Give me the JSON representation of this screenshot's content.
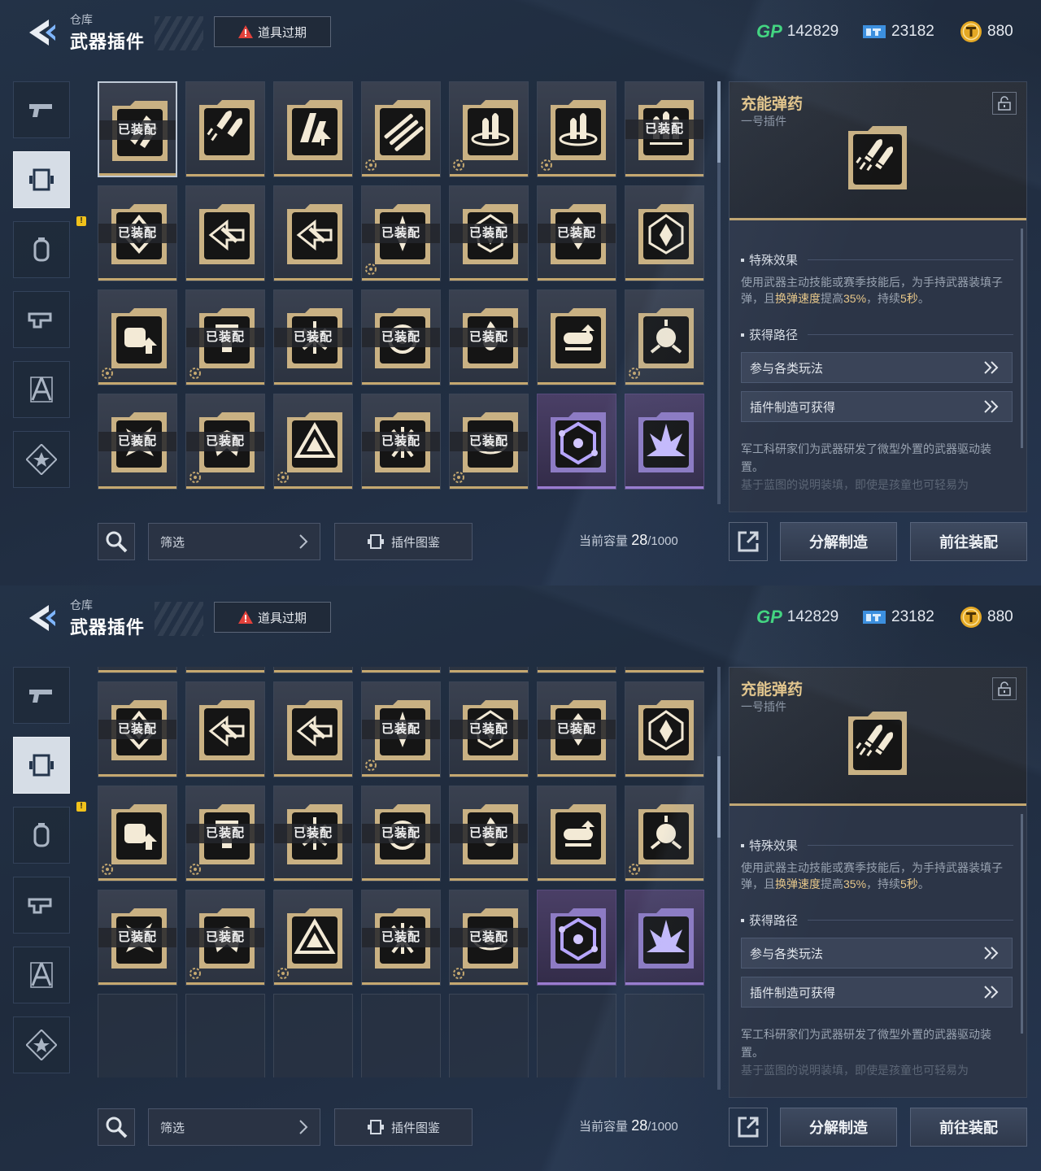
{
  "header": {
    "breadcrumb": "仓库",
    "title": "武器插件",
    "expire_label": "道具过期",
    "currencies": [
      {
        "icon": "gp-icon",
        "label": "GP",
        "value": "142829"
      },
      {
        "icon": "ticket-icon",
        "value": "23182"
      },
      {
        "icon": "coin-icon",
        "value": "880"
      }
    ]
  },
  "sidebar": {
    "tabs": [
      {
        "name": "pistol",
        "icon": "pistol-icon",
        "active": false
      },
      {
        "name": "plugin",
        "icon": "plugin-icon",
        "active": true
      },
      {
        "name": "grenade",
        "icon": "grenade-icon",
        "active": false,
        "alert": "!"
      },
      {
        "name": "gun-mod",
        "icon": "gun-mod-icon",
        "active": false
      },
      {
        "name": "compass",
        "icon": "compass-icon",
        "active": false
      },
      {
        "name": "star-badge",
        "icon": "star-badge-icon",
        "active": false
      }
    ]
  },
  "grid": {
    "equipped_label": "已装配",
    "items": [
      {
        "id": 1,
        "icon": "rockets-icon",
        "equipped": true,
        "selected": true,
        "rarity": "gold"
      },
      {
        "id": 2,
        "icon": "charged-rounds-icon",
        "equipped": false,
        "rarity": "gold"
      },
      {
        "id": 3,
        "icon": "ammo-up-icon",
        "equipped": false,
        "rarity": "gold"
      },
      {
        "id": 4,
        "icon": "missile-trio-icon",
        "equipped": false,
        "rarity": "gold",
        "gear": true
      },
      {
        "id": 5,
        "icon": "bullet-ring-icon",
        "equipped": false,
        "rarity": "gold",
        "gear": true
      },
      {
        "id": 6,
        "icon": "bullet-ring-icon",
        "equipped": false,
        "rarity": "gold",
        "gear": true
      },
      {
        "id": 7,
        "icon": "bullet-burst-icon",
        "equipped": true,
        "rarity": "gold"
      },
      {
        "id": 8,
        "icon": "diamond-icon",
        "equipped": true,
        "rarity": "gold"
      },
      {
        "id": 9,
        "icon": "dash-arrow-icon",
        "equipped": false,
        "rarity": "gold"
      },
      {
        "id": 10,
        "icon": "dash-arrow-icon",
        "equipped": false,
        "rarity": "gold"
      },
      {
        "id": 11,
        "icon": "spike-icon",
        "equipped": true,
        "rarity": "gold",
        "gear": true
      },
      {
        "id": 12,
        "icon": "shield-core-icon",
        "equipped": true,
        "rarity": "gold"
      },
      {
        "id": 13,
        "icon": "crystal-icon",
        "equipped": true,
        "rarity": "gold"
      },
      {
        "id": 14,
        "icon": "crystal-frame-icon",
        "equipped": false,
        "rarity": "gold"
      },
      {
        "id": 15,
        "icon": "fist-up-icon",
        "equipped": false,
        "rarity": "gold",
        "gear": true
      },
      {
        "id": 16,
        "icon": "tower-icon",
        "equipped": true,
        "rarity": "gold",
        "gear": true
      },
      {
        "id": 17,
        "icon": "blast-icon",
        "equipped": true,
        "rarity": "gold"
      },
      {
        "id": 18,
        "icon": "core-burst-icon",
        "equipped": true,
        "rarity": "gold"
      },
      {
        "id": 19,
        "icon": "flame-icon",
        "equipped": true,
        "rarity": "gold"
      },
      {
        "id": 20,
        "icon": "cartridge-icon",
        "equipped": false,
        "rarity": "gold"
      },
      {
        "id": 21,
        "icon": "explosion-icon",
        "equipped": false,
        "rarity": "gold",
        "gear": true
      },
      {
        "id": 22,
        "icon": "shatter-icon",
        "equipped": true,
        "rarity": "gold"
      },
      {
        "id": 23,
        "icon": "wing-icon",
        "equipped": true,
        "rarity": "gold",
        "gear": true
      },
      {
        "id": 24,
        "icon": "pyramid-icon",
        "equipped": false,
        "rarity": "gold",
        "gear": true
      },
      {
        "id": 25,
        "icon": "splinter-icon",
        "equipped": true,
        "rarity": "gold"
      },
      {
        "id": 26,
        "icon": "orbit-icon",
        "equipped": true,
        "rarity": "gold",
        "gear": true
      },
      {
        "id": 27,
        "icon": "hex-network-icon",
        "equipped": false,
        "rarity": "purple"
      },
      {
        "id": 28,
        "icon": "spike-burst-icon",
        "equipped": false,
        "rarity": "purple"
      }
    ]
  },
  "detail": {
    "name": "充能弹药",
    "slot": "一号插件",
    "icon": "charged-rounds-icon",
    "effect_heading": "特殊效果",
    "effect_pre": "使用武器主动技能或赛季技能后，为手持武器装填子弹，且",
    "effect_hl1": "换弹速度",
    "effect_mid1": "提高",
    "effect_hl2": "35%",
    "effect_mid2": "，持续",
    "effect_hl3": "5秒",
    "effect_post": "。",
    "route_heading": "获得路径",
    "routes": [
      "参与各类玩法",
      "插件制造可获得"
    ],
    "description": "军工科研家们为武器研发了微型外置的武器驱动装置。",
    "description_more": "基于蓝图的说明装填，即使是孩童也可轻易为"
  },
  "footer": {
    "filter_label": "筛选",
    "codex_label": "插件图鉴",
    "capacity_label": "当前容量",
    "capacity_current": "28",
    "capacity_total": "/1000",
    "salvage_label": "分解制造",
    "equip_label": "前往装配"
  },
  "colors": {
    "gold": "#c5a870",
    "purple": "#9a7cd0",
    "highlight": "#e8c88a"
  }
}
